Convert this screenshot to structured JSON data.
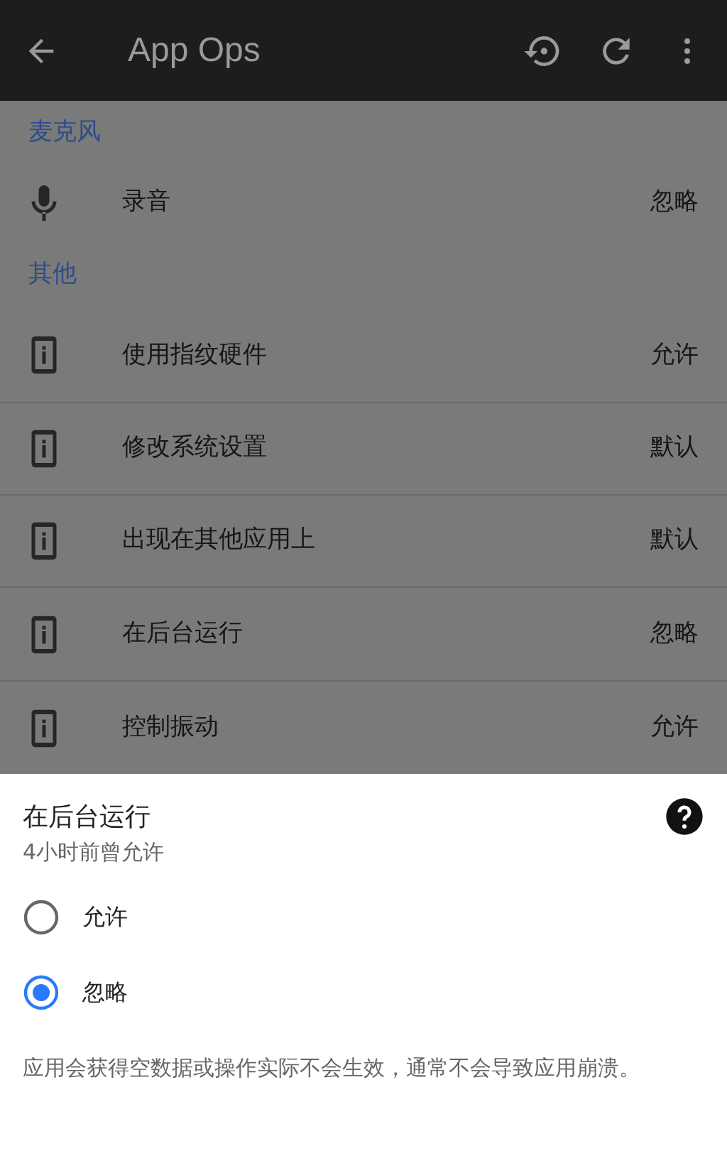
{
  "app_bar": {
    "title": "App Ops"
  },
  "sections": [
    {
      "header": "麦克风",
      "items": [
        {
          "kind": "mic",
          "label": "录音",
          "mode": "忽略"
        }
      ]
    },
    {
      "header": "其他",
      "items": [
        {
          "kind": "phone",
          "label": "使用指纹硬件",
          "mode": "允许"
        },
        {
          "kind": "phone",
          "label": "修改系统设置",
          "mode": "默认"
        },
        {
          "kind": "phone",
          "label": "出现在其他应用上",
          "mode": "默认"
        },
        {
          "kind": "phone",
          "label": "在后台运行",
          "mode": "忽略"
        },
        {
          "kind": "phone",
          "label": "控制振动",
          "mode": "允许"
        }
      ]
    }
  ],
  "sheet": {
    "title": "在后台运行",
    "subtitle": "4小时前曾允许",
    "options": [
      {
        "label": "允许",
        "selected": false
      },
      {
        "label": "忽略",
        "selected": true
      }
    ],
    "description": "应用会获得空数据或操作实际不会生效，通常不会导致应用崩溃。"
  }
}
